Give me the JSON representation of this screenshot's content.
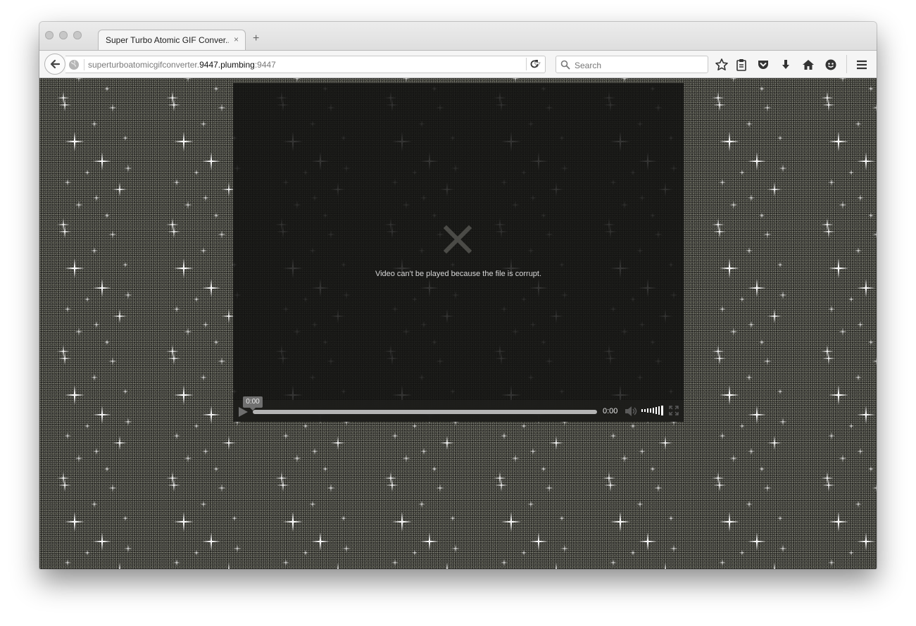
{
  "browser": {
    "tab": {
      "title": "Super Turbo Atomic GIF Conver...",
      "close": "×"
    },
    "new_tab": "+",
    "url": {
      "prefix": "superturboatomicgifconverter.",
      "host": "9447.plumbing",
      "suffix": ":9447"
    },
    "search": {
      "placeholder": "Search"
    },
    "toolbar_icons": [
      "bookmark-star-icon",
      "reading-list-icon",
      "pocket-icon",
      "download-icon",
      "home-icon",
      "hello-icon",
      "menu-icon"
    ]
  },
  "video": {
    "error_message": "Video can't be played because the file is corrupt.",
    "tooltip_time": "0:00",
    "current_time": "0:00",
    "progress": 0
  },
  "colors": {
    "page_background": "#3a3a34",
    "sparkle": "#ffffff",
    "video_overlay": "#121210"
  }
}
